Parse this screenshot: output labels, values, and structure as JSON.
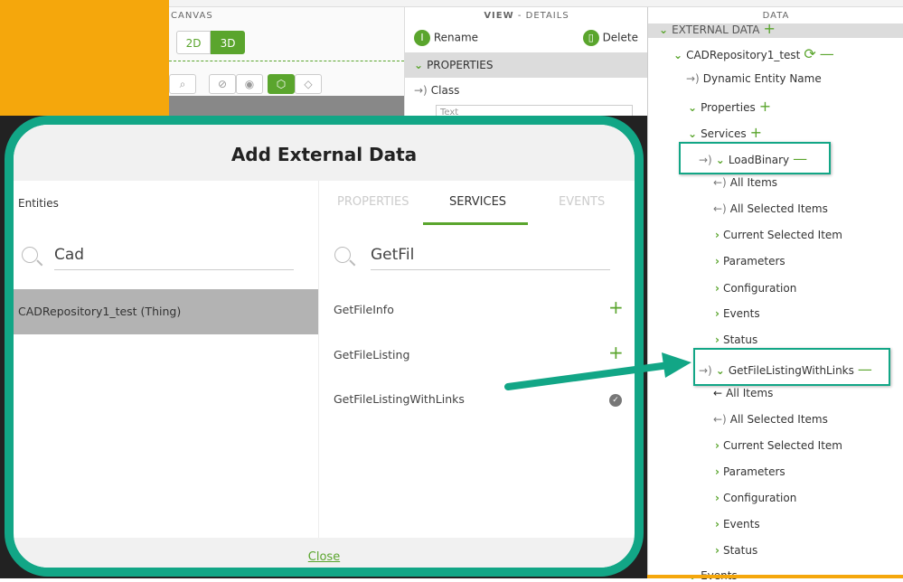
{
  "canvas": {
    "header": "CANVAS",
    "btn_2d": "2D",
    "btn_3d": "3D"
  },
  "details": {
    "header_bold": "VIEW",
    "header_rest": "- DETAILS",
    "rename": "Rename",
    "delete": "Delete",
    "properties": "PROPERTIES",
    "class_label": "Class",
    "class_value": "Text"
  },
  "data_panel": {
    "header": "DATA",
    "external": "EXTERNAL DATA",
    "entity": "CADRepository1_test",
    "dyn": "Dynamic Entity Name",
    "properties": "Properties",
    "services": "Services",
    "events_bottom": "Events",
    "svc1": {
      "name": "LoadBinary",
      "children": [
        "All Items",
        "All Selected Items",
        "Current Selected Item",
        "Parameters",
        "Configuration",
        "Events",
        "Status"
      ]
    },
    "svc2": {
      "name": "GetFileListingWithLinks",
      "children": [
        "All Items",
        "All Selected Items",
        "Current Selected Item",
        "Parameters",
        "Configuration",
        "Events",
        "Status"
      ]
    }
  },
  "modal": {
    "title": "Add External Data",
    "entities_label": "Entities",
    "entity_search": "Cad",
    "entity_result": "CADRepository1_test (Thing)",
    "tabs": [
      "PROPERTIES",
      "SERVICES",
      "EVENTS"
    ],
    "service_search": "GetFil",
    "services": [
      "GetFileInfo",
      "GetFileListing",
      "GetFileListingWithLinks"
    ],
    "close": "Close"
  },
  "colors": {
    "accent": "#5aa52d",
    "highlight": "#12a686",
    "orange": "#f5a70c"
  }
}
